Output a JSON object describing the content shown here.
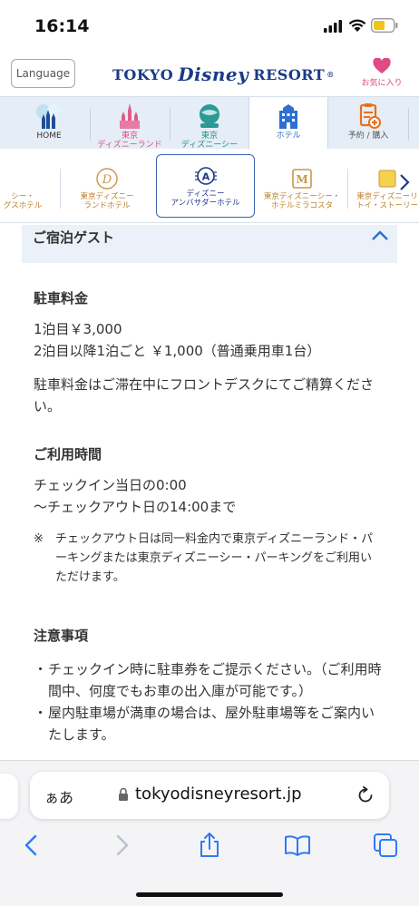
{
  "status_bar": {
    "time": "16:14"
  },
  "header": {
    "language_label": "Language",
    "logo": {
      "part1": "TOKYO",
      "part2": "Disney",
      "part3": "RESORT",
      "reg": "®"
    },
    "favorites_label": "お気に入り"
  },
  "main_tabs": [
    {
      "label": "HOME"
    },
    {
      "label": "東京\nディズニーランド"
    },
    {
      "label": "東京\nディズニーシー"
    },
    {
      "label": "ホテル",
      "active": true
    },
    {
      "label": "予約 / 購入"
    }
  ],
  "hotel_tabs": [
    {
      "label": "シー・\nグスホテル"
    },
    {
      "label": "東京ディズニー\nランドホテル"
    },
    {
      "label": "ディズニー\nアンバサダーホテル",
      "active": true
    },
    {
      "label": "東京ディズニーシー・\nホテルミラコスタ"
    },
    {
      "label": "東京ディズニーリ\nトイ・ストーリー"
    }
  ],
  "accordion_title": "ご宿泊ゲスト",
  "parking_fee": {
    "heading": "駐車料金",
    "line1": "1泊目￥3,000",
    "line2": "2泊目以降1泊ごと ￥1,000（普通乗用車1台）",
    "note": "駐車料金はご滞在中にフロントデスクにてご精算ください。"
  },
  "usage_time": {
    "heading": "ご利用時間",
    "line1": "チェックイン当日の0:00",
    "line2": "〜チェックアウト日の14:00まで",
    "note_mark": "※",
    "note": "チェックアウト日は同一料金内で東京ディズニーランド・パーキングまたは東京ディズニーシー・パーキングをご利用いただけます。"
  },
  "notes": {
    "heading": "注意事項",
    "bullet": "・",
    "items": [
      "チェックイン時に駐車券をご提示ください。（ご利用時間中、何度でもお車の出入庫が可能です。）",
      "屋内駐車場が満車の場合は、屋外駐車場等をご案内いたします。"
    ]
  },
  "browser": {
    "aa_label": "ぁあ",
    "url": "tokyodisneyresort.jp"
  },
  "colors": {
    "brand": "#1b3a86",
    "accent": "#2f6fd0",
    "favorite": "#e04a86",
    "gold": "#b8812e"
  }
}
